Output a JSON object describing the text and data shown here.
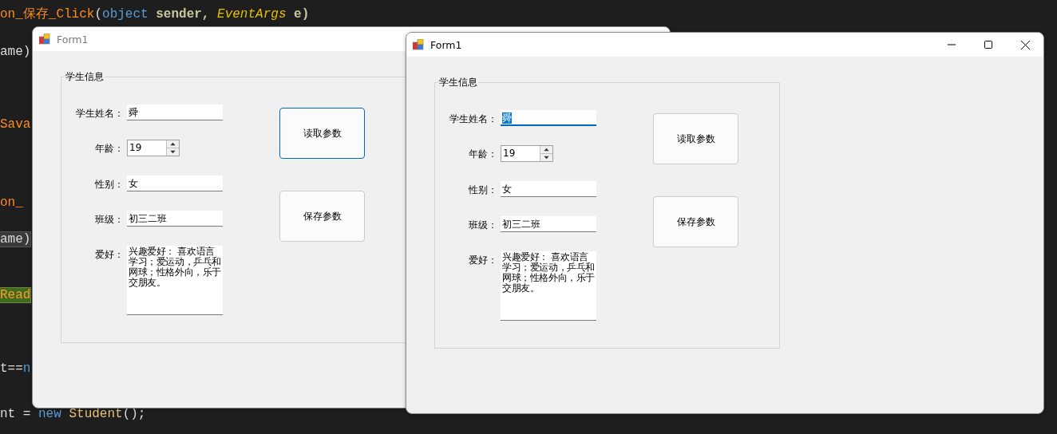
{
  "editor": {
    "lines": [
      {
        "tokens": [
          {
            "text": "on_保存_Click",
            "kind": "method"
          },
          {
            "text": "(",
            "kind": "plain"
          },
          {
            "text": "object",
            "kind": "keyword"
          },
          {
            "text": " sender, ",
            "kind": "param"
          },
          {
            "text": "EventArgs",
            "kind": "type"
          },
          {
            "text": " e)",
            "kind": "param"
          }
        ]
      },
      {
        "tokens": [
          {
            "text": "ame)",
            "kind": "plain"
          }
        ]
      },
      {
        "tokens": [
          {
            "text": "Sava",
            "kind": "method"
          }
        ]
      },
      {
        "tokens": [
          {
            "text": "on_",
            "kind": "method"
          }
        ]
      },
      {
        "tokens": [
          {
            "text": "ame)",
            "kind": "reference"
          }
        ]
      },
      {
        "tokens": [
          {
            "text": "Read",
            "kind": "highlight"
          }
        ]
      },
      {
        "tokens": [
          {
            "text": "t==",
            "kind": "plain"
          },
          {
            "text": "n",
            "kind": "keyword"
          }
        ]
      },
      {
        "tokens": [
          {
            "text": "nt = ",
            "kind": "plain"
          },
          {
            "text": "new",
            "kind": "keyword"
          },
          {
            "text": " Student",
            "kind": "class"
          },
          {
            "text": "();",
            "kind": "plain"
          }
        ]
      }
    ]
  },
  "windows": [
    {
      "title": "Form1",
      "active": false,
      "group": {
        "title": "学生信息",
        "fields": [
          {
            "kind": "text",
            "label": "学生姓名：",
            "value": "舜",
            "focused": false
          },
          {
            "kind": "spinner",
            "label": "年龄：",
            "value": "19"
          },
          {
            "kind": "text",
            "label": "性别：",
            "value": "女",
            "focused": false
          },
          {
            "kind": "text",
            "label": "班级：",
            "value": "初三二班",
            "focused": false
          },
          {
            "kind": "multiline",
            "label": "爱好：",
            "value": "兴趣爱好：  喜欢语言学习；爱运动，乒乓和网球；性格外向，乐于交朋友。"
          }
        ]
      },
      "buttons": [
        {
          "label": "读取参数",
          "focused": true
        },
        {
          "label": "保存参数",
          "focused": false
        }
      ]
    },
    {
      "title": "Form1",
      "active": true,
      "group": {
        "title": "学生信息",
        "fields": [
          {
            "kind": "text",
            "label": "学生姓名：",
            "value": "舜",
            "focused": true
          },
          {
            "kind": "spinner",
            "label": "年龄：",
            "value": "19"
          },
          {
            "kind": "text",
            "label": "性别：",
            "value": "女",
            "focused": false
          },
          {
            "kind": "text",
            "label": "班级：",
            "value": "初三二班",
            "focused": false
          },
          {
            "kind": "multiline",
            "label": "爱好：",
            "value": "兴趣爱好：  喜欢语言学习；爱运动，乒乓和网球；性格外向，乐于交朋友。"
          }
        ]
      },
      "buttons": [
        {
          "label": "读取参数",
          "focused": false
        },
        {
          "label": "保存参数",
          "focused": false
        }
      ]
    }
  ]
}
